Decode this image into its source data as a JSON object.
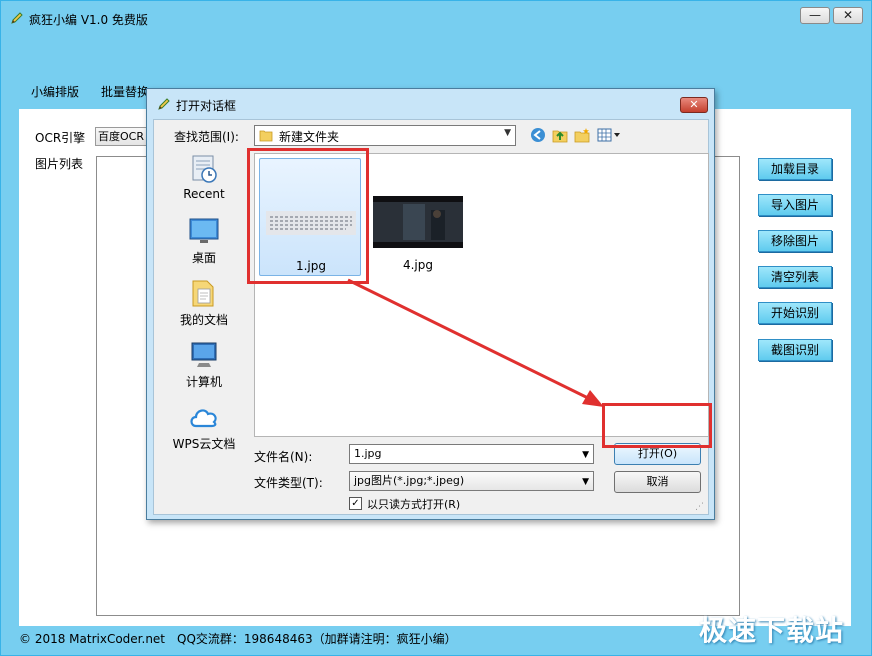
{
  "app": {
    "title": "疯狂小编 V1.0 免费版",
    "minimize_glyph": "—",
    "close_glyph": "✕",
    "menu": [
      "小编排版",
      "批量替换"
    ],
    "ocr_label": "OCR引擎",
    "ocr_value": "百度OCR",
    "imglist_label": "图片列表",
    "buttons": [
      "加载目录",
      "导入图片",
      "移除图片",
      "清空列表",
      "开始识别",
      "截图识别"
    ],
    "footer": "© 2018 MatrixCoder.net　QQ交流群：198648463（加群请注明：疯狂小编）",
    "watermark": "极速下载站"
  },
  "dialog": {
    "title": "打开对话框",
    "close_glyph": "✕",
    "lookin_label": "查找范围(I):",
    "lookin_value": "新建文件夹",
    "places": [
      "Recent",
      "桌面",
      "我的文档",
      "计算机",
      "WPS云文档"
    ],
    "files": [
      "1.jpg",
      "4.jpg"
    ],
    "filename_label": "文件名(N):",
    "filename_value": "1.jpg",
    "filetype_label": "文件类型(T):",
    "filetype_value": "jpg图片(*.jpg;*.jpeg)",
    "readonly_label": "以只读方式打开(R)",
    "readonly_checked": "✓",
    "open_button": "打开(O)",
    "cancel_button": "取消"
  },
  "colors": {
    "app_bg": "#77cef0",
    "button_bg": "#5fcbee",
    "annotation_red": "#e0302f"
  }
}
